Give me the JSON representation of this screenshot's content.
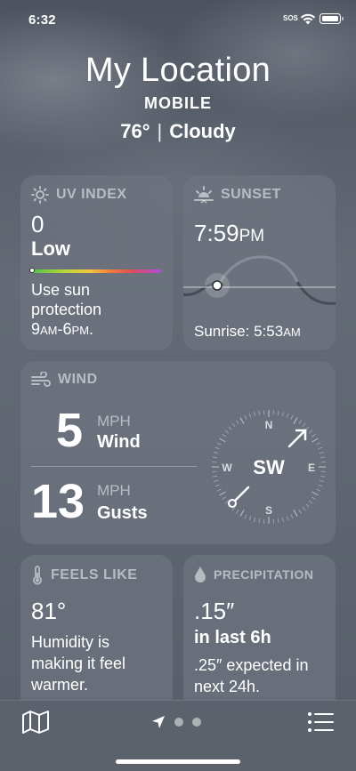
{
  "status_bar": {
    "time": "6:32",
    "sos": "SOS"
  },
  "header": {
    "location": "My Location",
    "sublocation": "MOBILE",
    "temperature": "76°",
    "condition": "Cloudy"
  },
  "uv": {
    "title": "UV INDEX",
    "value": "0",
    "level": "Low",
    "desc_line1": "Use sun",
    "desc_line2": "protection",
    "hours_start": "9",
    "hours_start_ampm": "AM",
    "hours_sep": "-",
    "hours_end": "6",
    "hours_end_ampm": "PM",
    "hours_period": "."
  },
  "sunset": {
    "title": "SUNSET",
    "time": "7:59",
    "time_ampm": "PM",
    "sunrise_label": "Sunrise: ",
    "sunrise_time": "5:53",
    "sunrise_ampm": "AM"
  },
  "wind": {
    "title": "WIND",
    "speed": "5",
    "speed_unit": "MPH",
    "speed_label": "Wind",
    "gusts": "13",
    "gusts_unit": "MPH",
    "gusts_label": "Gusts",
    "direction": "SW",
    "compass": {
      "n": "N",
      "e": "E",
      "s": "S",
      "w": "W"
    }
  },
  "feels_like": {
    "title": "FEELS LIKE",
    "value": "81°",
    "desc": "Humidity is making it feel warmer."
  },
  "precipitation": {
    "title": "PRECIPITATION",
    "amount": ".15″",
    "period": "in last 6h",
    "forecast": ".25″ expected in next 24h."
  },
  "colors": {
    "background": "#5b6370",
    "card": "#6e7580",
    "text": "#ffffff"
  },
  "icons": {
    "map": "map-icon",
    "list": "list-icon",
    "location": "location-arrow-icon"
  }
}
